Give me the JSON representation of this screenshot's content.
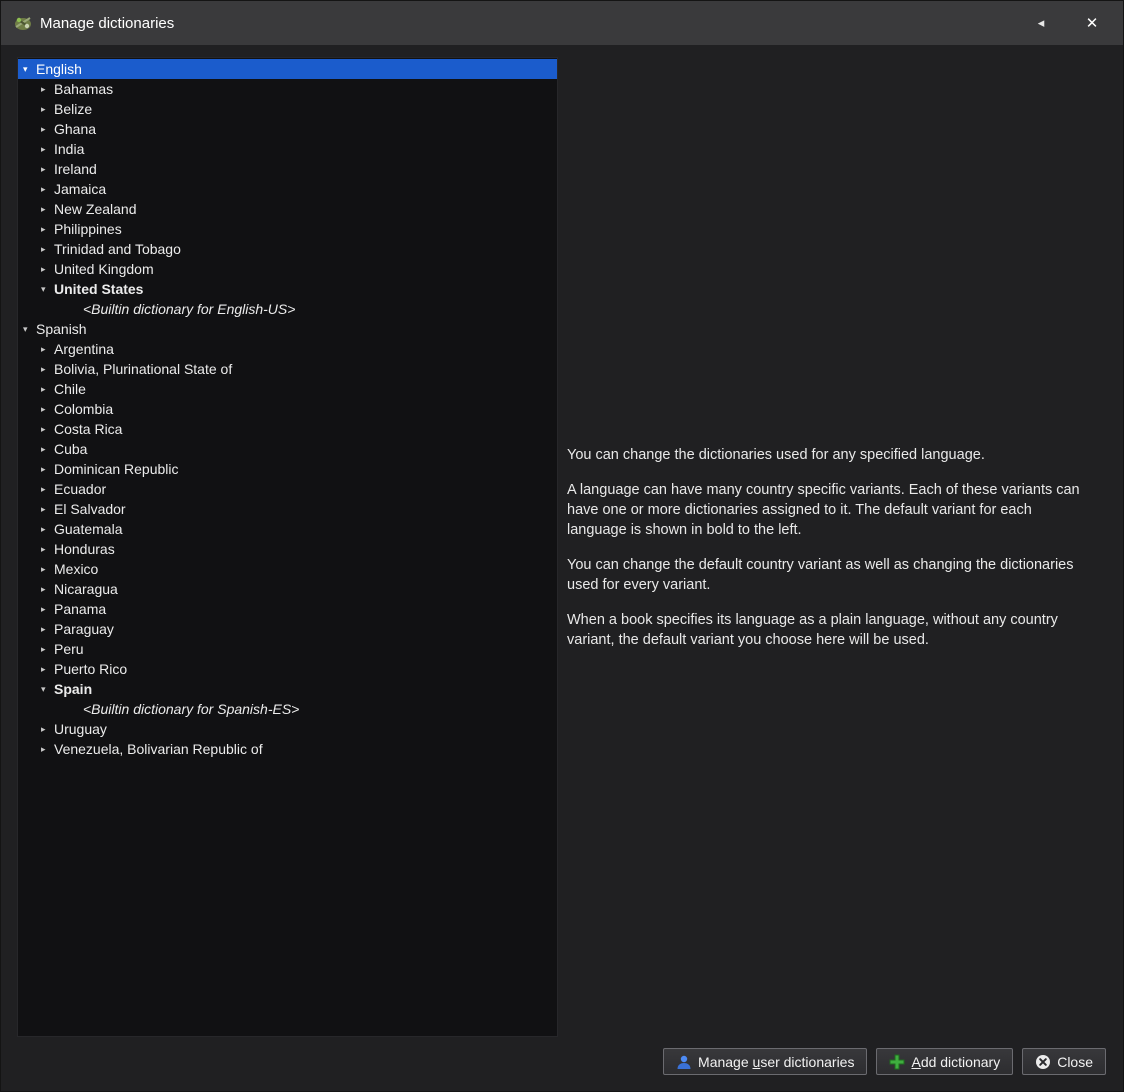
{
  "window": {
    "title": "Manage dictionaries",
    "back_icon": "◂",
    "close_icon": "✕"
  },
  "tree": {
    "items": [
      {
        "label": "English",
        "level": 0,
        "arrow": "expanded",
        "selected": true,
        "bold": false,
        "italic": false
      },
      {
        "label": "Bahamas",
        "level": 1,
        "arrow": "collapsed",
        "selected": false,
        "bold": false,
        "italic": false
      },
      {
        "label": "Belize",
        "level": 1,
        "arrow": "collapsed",
        "selected": false,
        "bold": false,
        "italic": false
      },
      {
        "label": "Ghana",
        "level": 1,
        "arrow": "collapsed",
        "selected": false,
        "bold": false,
        "italic": false
      },
      {
        "label": "India",
        "level": 1,
        "arrow": "collapsed",
        "selected": false,
        "bold": false,
        "italic": false
      },
      {
        "label": "Ireland",
        "level": 1,
        "arrow": "collapsed",
        "selected": false,
        "bold": false,
        "italic": false
      },
      {
        "label": "Jamaica",
        "level": 1,
        "arrow": "collapsed",
        "selected": false,
        "bold": false,
        "italic": false
      },
      {
        "label": "New Zealand",
        "level": 1,
        "arrow": "collapsed",
        "selected": false,
        "bold": false,
        "italic": false
      },
      {
        "label": "Philippines",
        "level": 1,
        "arrow": "collapsed",
        "selected": false,
        "bold": false,
        "italic": false
      },
      {
        "label": "Trinidad and Tobago",
        "level": 1,
        "arrow": "collapsed",
        "selected": false,
        "bold": false,
        "italic": false
      },
      {
        "label": "United Kingdom",
        "level": 1,
        "arrow": "collapsed",
        "selected": false,
        "bold": false,
        "italic": false
      },
      {
        "label": "United States",
        "level": 1,
        "arrow": "expanded",
        "selected": false,
        "bold": true,
        "italic": false
      },
      {
        "label": "<Builtin dictionary for English-US>",
        "level": 2,
        "arrow": "none",
        "selected": false,
        "bold": false,
        "italic": true
      },
      {
        "label": "Spanish",
        "level": 0,
        "arrow": "expanded",
        "selected": false,
        "bold": false,
        "italic": false
      },
      {
        "label": "Argentina",
        "level": 1,
        "arrow": "collapsed",
        "selected": false,
        "bold": false,
        "italic": false
      },
      {
        "label": "Bolivia, Plurinational State of",
        "level": 1,
        "arrow": "collapsed",
        "selected": false,
        "bold": false,
        "italic": false
      },
      {
        "label": "Chile",
        "level": 1,
        "arrow": "collapsed",
        "selected": false,
        "bold": false,
        "italic": false
      },
      {
        "label": "Colombia",
        "level": 1,
        "arrow": "collapsed",
        "selected": false,
        "bold": false,
        "italic": false
      },
      {
        "label": "Costa Rica",
        "level": 1,
        "arrow": "collapsed",
        "selected": false,
        "bold": false,
        "italic": false
      },
      {
        "label": "Cuba",
        "level": 1,
        "arrow": "collapsed",
        "selected": false,
        "bold": false,
        "italic": false
      },
      {
        "label": "Dominican Republic",
        "level": 1,
        "arrow": "collapsed",
        "selected": false,
        "bold": false,
        "italic": false
      },
      {
        "label": "Ecuador",
        "level": 1,
        "arrow": "collapsed",
        "selected": false,
        "bold": false,
        "italic": false
      },
      {
        "label": "El Salvador",
        "level": 1,
        "arrow": "collapsed",
        "selected": false,
        "bold": false,
        "italic": false
      },
      {
        "label": "Guatemala",
        "level": 1,
        "arrow": "collapsed",
        "selected": false,
        "bold": false,
        "italic": false
      },
      {
        "label": "Honduras",
        "level": 1,
        "arrow": "collapsed",
        "selected": false,
        "bold": false,
        "italic": false
      },
      {
        "label": "Mexico",
        "level": 1,
        "arrow": "collapsed",
        "selected": false,
        "bold": false,
        "italic": false
      },
      {
        "label": "Nicaragua",
        "level": 1,
        "arrow": "collapsed",
        "selected": false,
        "bold": false,
        "italic": false
      },
      {
        "label": "Panama",
        "level": 1,
        "arrow": "collapsed",
        "selected": false,
        "bold": false,
        "italic": false
      },
      {
        "label": "Paraguay",
        "level": 1,
        "arrow": "collapsed",
        "selected": false,
        "bold": false,
        "italic": false
      },
      {
        "label": "Peru",
        "level": 1,
        "arrow": "collapsed",
        "selected": false,
        "bold": false,
        "italic": false
      },
      {
        "label": "Puerto Rico",
        "level": 1,
        "arrow": "collapsed",
        "selected": false,
        "bold": false,
        "italic": false
      },
      {
        "label": "Spain",
        "level": 1,
        "arrow": "expanded",
        "selected": false,
        "bold": true,
        "italic": false
      },
      {
        "label": "<Builtin dictionary for Spanish-ES>",
        "level": 2,
        "arrow": "none",
        "selected": false,
        "bold": false,
        "italic": true
      },
      {
        "label": "Uruguay",
        "level": 1,
        "arrow": "collapsed",
        "selected": false,
        "bold": false,
        "italic": false
      },
      {
        "label": "Venezuela, Bolivarian Republic of",
        "level": 1,
        "arrow": "collapsed",
        "selected": false,
        "bold": false,
        "italic": false
      }
    ]
  },
  "info": {
    "paragraphs": [
      "You can change the dictionaries used for any specified language.",
      "A language can have many country specific variants. Each of these variants can have one or more dictionaries assigned to it. The default variant for each language is shown in bold to the left.",
      "You can change the default country variant as well as changing the dictionaries used for every variant.",
      "When a book specifies its language as a plain language, without any country variant, the default variant you choose here will be used."
    ]
  },
  "buttons": {
    "manage_user": {
      "pre": "Manage ",
      "key": "u",
      "post": "ser dictionaries"
    },
    "add": {
      "pre": "",
      "key": "A",
      "post": "dd dictionary"
    },
    "close": {
      "label": "Close"
    }
  },
  "colors": {
    "selection_blue": "#1b5ccc",
    "titlebar_gray": "#3a3a3c",
    "person_icon_blue": "#4d8bf5",
    "plus_icon_green": "#3fae3f"
  }
}
